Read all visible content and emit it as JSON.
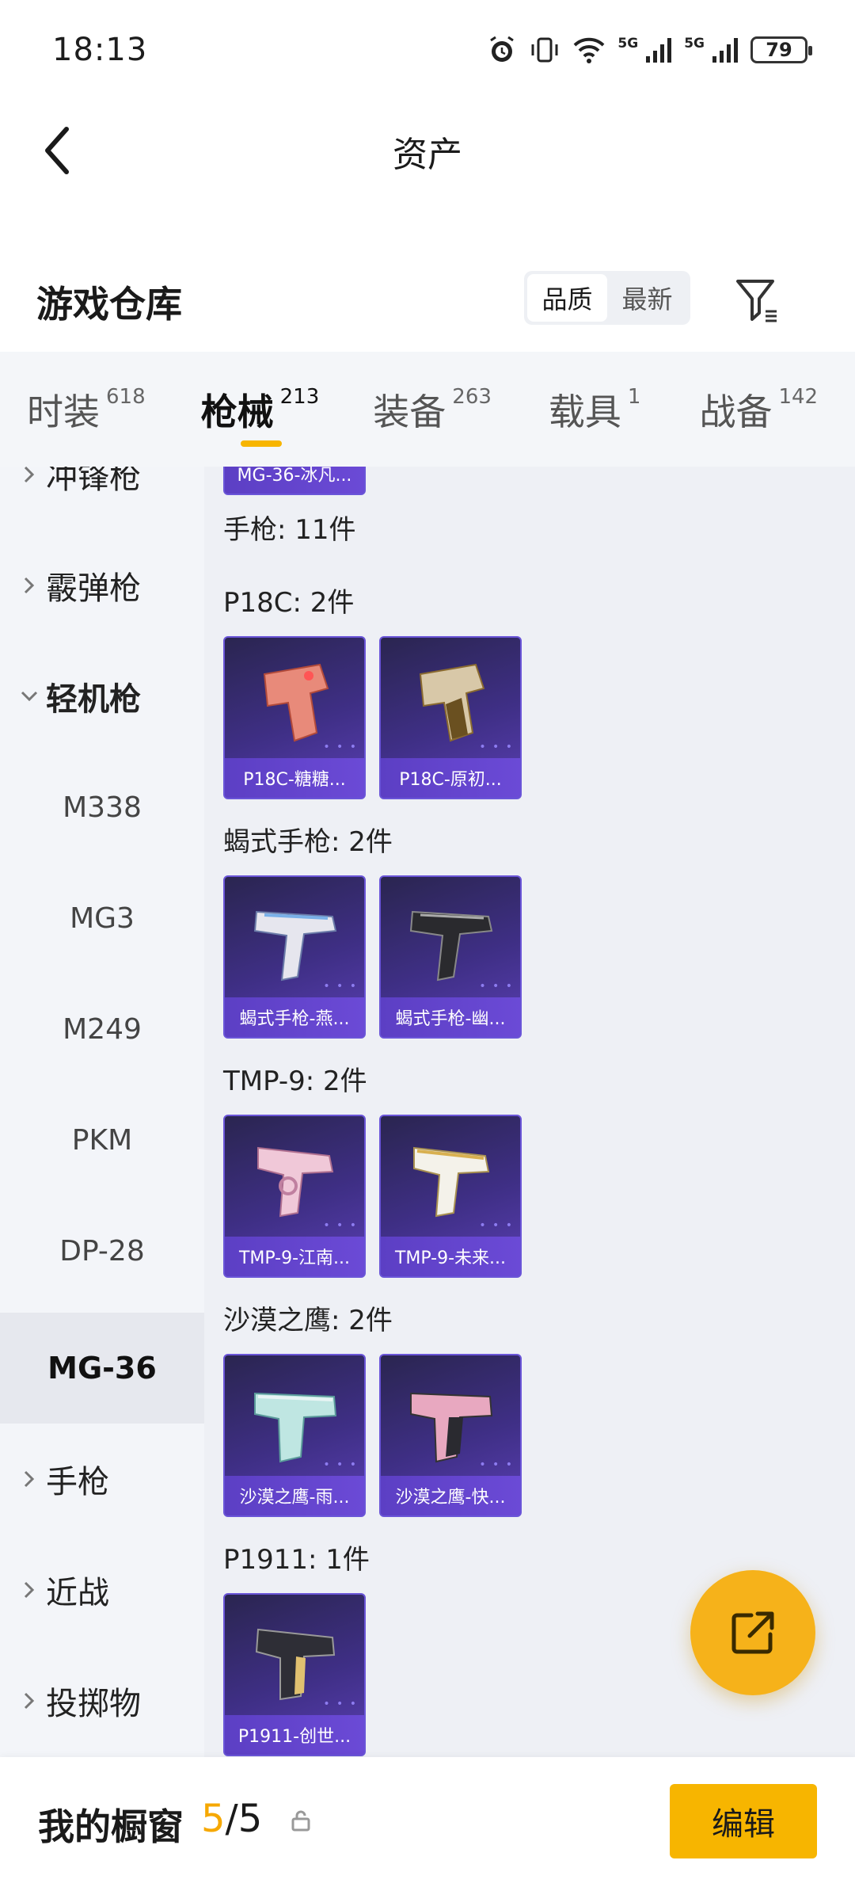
{
  "status_bar": {
    "time": "18:13",
    "battery": "79",
    "signal_label_1": "5G",
    "signal_label_2": "5G"
  },
  "header": {
    "title": "资产"
  },
  "warehouse": {
    "title": "游戏仓库",
    "sort_options": [
      "品质",
      "最新"
    ],
    "active_sort": "品质"
  },
  "tabs": [
    {
      "label": "时装",
      "count": "618"
    },
    {
      "label": "枪械",
      "count": "213",
      "active": true
    },
    {
      "label": "装备",
      "count": "263"
    },
    {
      "label": "载具",
      "count": "1"
    },
    {
      "label": "战备",
      "count": "142"
    }
  ],
  "categories": {
    "smg": "冲锋枪",
    "shotgun": "霰弹枪",
    "lmg": "轻机枪",
    "lmg_subs": [
      "M338",
      "MG3",
      "M249",
      "PKM",
      "DP-28",
      "MG-36"
    ],
    "active_sub": "MG-36",
    "pistol": "手枪",
    "melee": "近战",
    "throwable": "投掷物"
  },
  "content": {
    "prev_card_caption": "MG-36-冰凡...",
    "pistol_total": "手枪: 11件",
    "groups": [
      {
        "label": "P18C: 2件",
        "items": [
          "P18C-糖糖...",
          "P18C-原初..."
        ]
      },
      {
        "label": "蝎式手枪: 2件",
        "items": [
          "蝎式手枪-燕...",
          "蝎式手枪-幽..."
        ]
      },
      {
        "label": "TMP-9: 2件",
        "items": [
          "TMP-9-江南...",
          "TMP-9-未来..."
        ]
      },
      {
        "label": "沙漠之鹰: 2件",
        "items": [
          "沙漠之鹰-雨...",
          "沙漠之鹰-快..."
        ]
      },
      {
        "label": "P1911: 1件",
        "items": [
          "P1911-创世..."
        ]
      }
    ]
  },
  "bottom_bar": {
    "label": "我的橱窗",
    "current": "5",
    "separator": "/",
    "total": "5",
    "edit_label": "编辑"
  },
  "colors": {
    "accent": "#f7b500",
    "card_purple": "#5c3fc4",
    "panel_bg": "#eef0f5"
  },
  "icons": {
    "back": "chevron-left-icon",
    "filter": "filter-icon",
    "share": "share-external-icon",
    "lock": "lock-icon"
  }
}
